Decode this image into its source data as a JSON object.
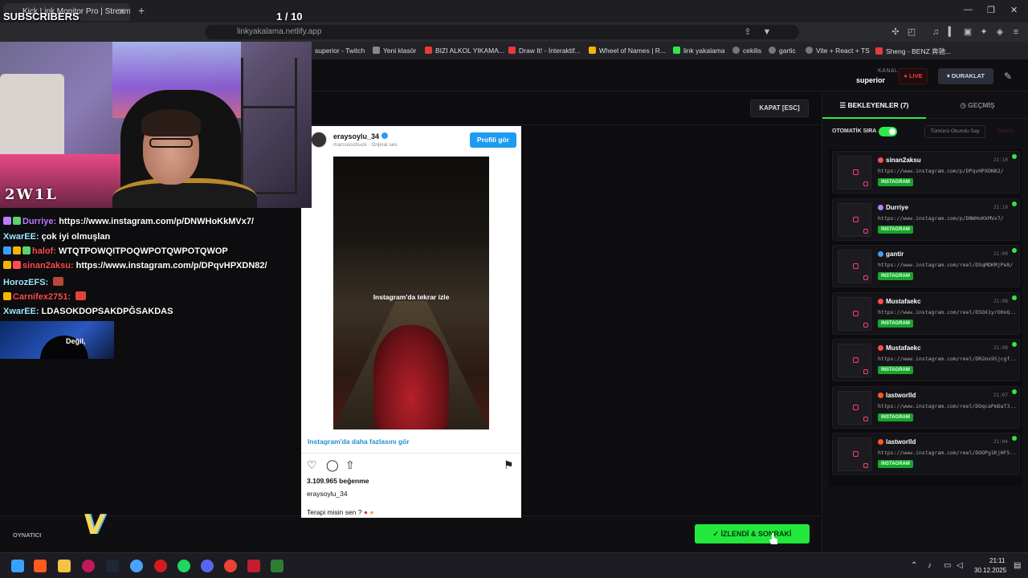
{
  "browser": {
    "tab_title": "Kick Link Monitor Pro | Stream",
    "url": "linkyakalama.netlify.app",
    "bookmarks": [
      {
        "label": "superior - Twitch",
        "color": "#9146ff"
      },
      {
        "label": "Yeni klasör",
        "color": "#999999"
      },
      {
        "label": "BIZI ALKOL YIKAMA...",
        "color": "#e63b3b"
      },
      {
        "label": "Draw It! - İnteraktif...",
        "color": "#e63b3b"
      },
      {
        "label": "Wheel of Names | R...",
        "color": "#f5b400"
      },
      {
        "label": "link yakalama",
        "color": "#2ee84a"
      },
      {
        "label": "cekilis",
        "color": "#aaaaaa"
      },
      {
        "label": "gartic",
        "color": "#aaaaaa"
      },
      {
        "label": "Vite + React + TS",
        "color": "#aaaaaa"
      },
      {
        "label": "Sheng - BENZ 奔驰...",
        "color": "#e63b3b"
      }
    ]
  },
  "overlay": {
    "subscribers": "SUBSCRIBERS",
    "counter": "1  / 10",
    "logo": "2W1L",
    "media_text": "Değil,"
  },
  "chat": [
    {
      "name": "Durriye:",
      "name_color": "#c07cff",
      "text": "https://www.instagram.com/p/DNWHoKkMVx7/",
      "badges": [
        "#c07cff",
        "#59d36a"
      ]
    },
    {
      "name": "XwarEE:",
      "name_color": "#9fe7ff",
      "text": "çok iyi olmuşlan",
      "badges": []
    },
    {
      "name": "halof:",
      "name_color": "#ff4d4d",
      "text": "WTQTPOWQITPOQWPOTQWPOTQWOP",
      "badges": [
        "#3aa0ff",
        "#f5b400",
        "#59d36a"
      ]
    },
    {
      "name": "sinan2aksu:",
      "name_color": "#ff4d4d",
      "text": "https://www.instagram.com/p/DPqvHPXDN82/",
      "badges": [
        "#f5b400",
        "#ff4d4d"
      ]
    },
    {
      "name": "HorozEFS:",
      "name_color": "#9fe7ff",
      "text": "",
      "badges": []
    },
    {
      "name": "Carnifex2751:",
      "name_color": "#ff4d4d",
      "text": "",
      "badges": [
        "#f5b400"
      ]
    },
    {
      "name": "XwarEE:",
      "name_color": "#9fe7ff",
      "text": "LDASOKDOPSAKDPĞSAKDAS",
      "badges": []
    }
  ],
  "header": {
    "kanal_label": "KANAL",
    "kanal_value": "superior",
    "live_label": "LIVE",
    "pause_label": "DURAKLAT"
  },
  "player": {
    "close_label": "KAPAT [ESC]",
    "footer_label": "OYNATICI",
    "done_label": "İZLENDİ & SONRAKİ"
  },
  "instagram": {
    "username": "eraysoylu_34",
    "subtitle": "marcosschuck · Orijinal ses",
    "profile_button": "Profili gör",
    "replay_text": "Instagram'da tekrar izle",
    "more_link": "Instagram'da daha fazlasını gör",
    "likes": "3.109.965 beğenme",
    "owner": "eraysoylu_34",
    "caption": "Terapi misin sen ?"
  },
  "sidebar": {
    "tab_waiting": "BEKLEYENLER (7)",
    "tab_history": "GEÇMİŞ",
    "auto_label": "OTOMATİK SIRA",
    "auto_on": true,
    "mark_all": "Tümünü Okundu Say",
    "clear": "Temizle",
    "queue": [
      {
        "user": "sinan2aksu",
        "dot": "#ff4d4d",
        "time": "21:10",
        "url": "https://www.instagram.com/p/DPqvHPXDN82/",
        "badge": "INSTAGRAM"
      },
      {
        "user": "Durriye",
        "dot": "#c07cff",
        "time": "21:10",
        "url": "https://www.instagram.com/p/DNWHoKkMVx7/",
        "badge": "INSTAGRAM"
      },
      {
        "user": "gantir",
        "dot": "#3aa0ff",
        "time": "21:09",
        "url": "https://www.instagram.com/reel/DSqMDKMjPe8/",
        "badge": "INSTAGRAM"
      },
      {
        "user": "Mustafaekc",
        "dot": "#ff4d4d",
        "time": "21:08",
        "url": "https://www.instagram.com/reel/DSOX1yrOHoQ...",
        "badge": "INSTAGRAM"
      },
      {
        "user": "Mustafaekc",
        "dot": "#ff4d4d",
        "time": "21:08",
        "url": "https://www.instagram.com/reel/DR2ms9Sjcgf...",
        "badge": "INSTAGRAM"
      },
      {
        "user": "lastworlld",
        "dot": "#ff5a1f",
        "time": "21:07",
        "url": "https://www.instagram.com/reel/DOqcaPmDaT3...",
        "badge": "INSTAGRAM"
      },
      {
        "user": "lastworlld",
        "dot": "#ff5a1f",
        "time": "21:04",
        "url": "https://www.instagram.com/reel/DOOPg1KjHF5...",
        "badge": "INSTAGRAM"
      }
    ]
  },
  "taskbar": {
    "time": "21:11",
    "date": "30.12.2025"
  }
}
